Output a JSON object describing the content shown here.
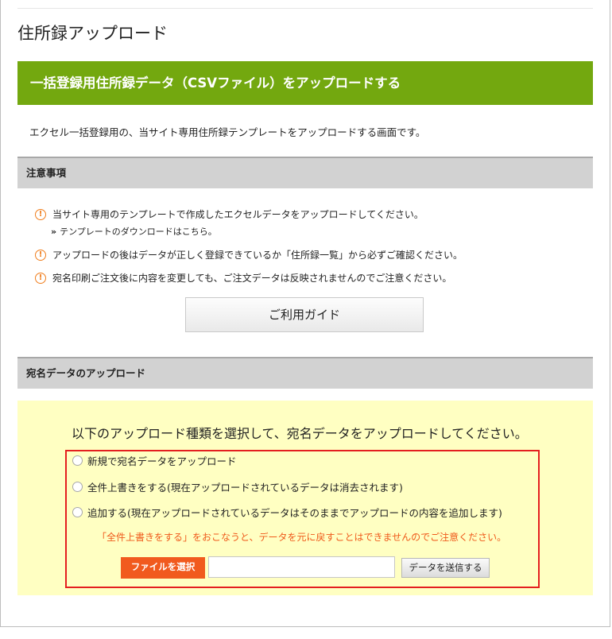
{
  "page": {
    "title": "住所録アップロード"
  },
  "banner": {
    "title": "一括登録用住所録データ（CSVファイル）をアップロードする"
  },
  "description": "エクセル一括登録用の、当サイト専用住所録テンプレートをアップロードする画面です。",
  "notes_section": {
    "header": "注意事項",
    "items": [
      "当サイト専用のテンプレートで作成したエクセルデータをアップロードしてください。",
      "アップロードの後はデータが正しく登録できているか「住所録一覧」から必ずご確認ください。",
      "宛名印刷ご注文後に内容を変更しても、ご注文データは反映されませんのでご注意ください。"
    ],
    "template_link": "テンプレートのダウンロードはこちら。",
    "guide_button": "ご利用ガイド"
  },
  "upload_section": {
    "header": "宛名データのアップロード",
    "instruction": "以下のアップロード種類を選択して、宛名データをアップロードしてください。",
    "options": [
      "新規で宛名データをアップロード",
      "全件上書きをする(現在アップロードされているデータは消去されます)",
      "追加する(現在アップロードされているデータはそのままでアップロードの内容を追加します)"
    ],
    "warning": "「全件上書きをする」をおこなうと、データを元に戻すことはできませんのでご注意ください。",
    "file_button": "ファイルを選択",
    "file_value": "",
    "submit_button": "データを送信する"
  },
  "colors": {
    "banner_green": "#73a80f",
    "warning_orange": "#ef5a1b",
    "file_button_orange": "#f15a1e",
    "highlight_red": "#e41f1f",
    "panel_yellow": "#ffffc2"
  },
  "icons": {
    "notice": "exclamation-circle-icon",
    "link": "double-chevron-right-icon"
  }
}
